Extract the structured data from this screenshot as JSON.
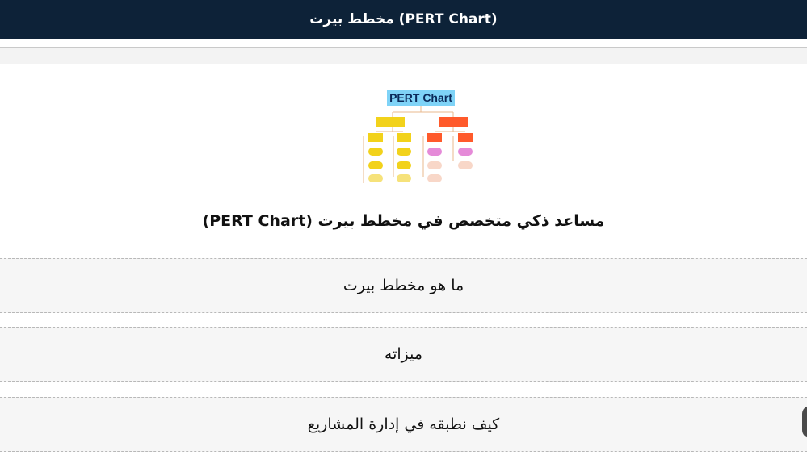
{
  "header": {
    "title": "مخطط بيرت (PERT Chart)"
  },
  "logo": {
    "label": "PERT Chart",
    "colors": {
      "label_bg": "#7fd3f7",
      "yellow": "#f2d21b",
      "yellow_light": "#f6e27a",
      "orange": "#ff5a2b",
      "pink": "#e58ad8",
      "peach": "#f8d7c8"
    }
  },
  "main": {
    "assistant_title": "مساعد ذكي متخصص في مخطط بيرت (PERT Chart)",
    "menu": [
      {
        "label": "ما هو مخطط بيرت"
      },
      {
        "label": "ميزاته"
      },
      {
        "label": "كيف نطبقه في إدارة المشاريع"
      }
    ]
  },
  "colors": {
    "header_bg": "#0d2238",
    "menu_bg": "#f6f6f6"
  }
}
